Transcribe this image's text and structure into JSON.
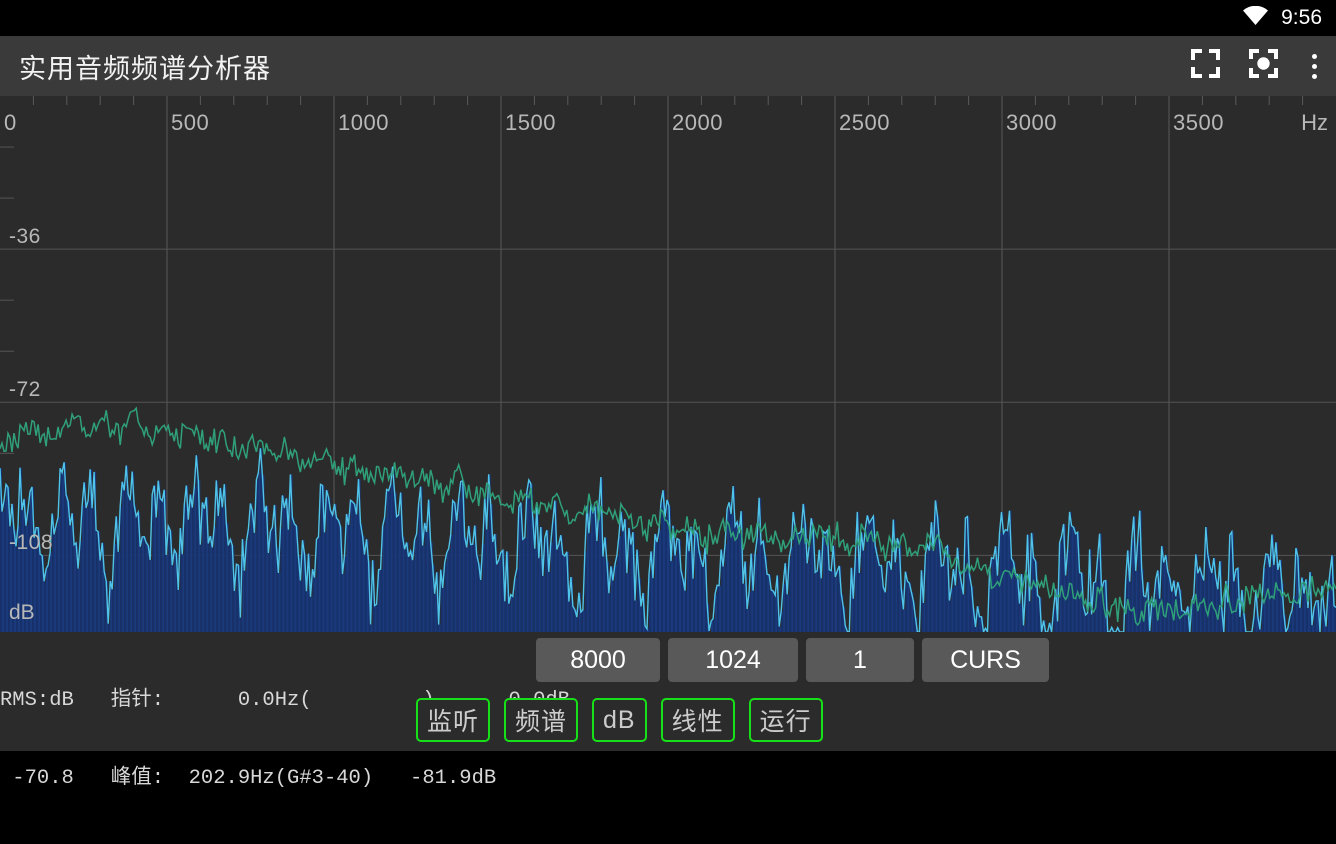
{
  "status_bar": {
    "wifi_icon": "wifi-icon",
    "time": "9:56"
  },
  "app_bar": {
    "title": "实用音频频谱分析器",
    "actions": [
      {
        "icon": "fullscreen-icon",
        "name": "fullscreen-button"
      },
      {
        "icon": "capture-focus-icon",
        "name": "capture-button"
      },
      {
        "icon": "overflow-menu-icon",
        "name": "overflow-menu-button"
      }
    ]
  },
  "readout": {
    "line1": "RMS:dB   指针:      0.0Hz(         )      0.0dB",
    "line2": " -70.8   峰值:  202.9Hz(G#3-40)   -81.9dB",
    "rms_label": "RMS:dB",
    "rms_value": "-70.8",
    "pointer_label": "指针:",
    "pointer_freq": "0.0Hz(         )",
    "pointer_db": "0.0dB",
    "peak_label": "峰值:",
    "peak_freq": "202.9Hz(G#3-40)",
    "peak_db": "-81.9dB"
  },
  "param_buttons": [
    {
      "label": "8000",
      "name": "sample-rate-button"
    },
    {
      "label": "1024",
      "name": "fft-length-button"
    },
    {
      "label": "1",
      "name": "average-button"
    },
    {
      "label": "CURS",
      "name": "cursor-button"
    }
  ],
  "mode_buttons": [
    {
      "label": "监听",
      "name": "monitor-button"
    },
    {
      "label": "频谱",
      "name": "spectrum-button"
    },
    {
      "label": "dB",
      "name": "db-scale-button"
    },
    {
      "label": "线性",
      "name": "linear-button"
    },
    {
      "label": "运行",
      "name": "run-button"
    }
  ],
  "colors": {
    "accent_green": "#18e018",
    "peak_trace": "#2fa07a",
    "live_trace": "#4fc3e8",
    "fill": "#16316b",
    "plot_bg": "#2b2b2b",
    "app_bar_bg": "#3a3a3a",
    "button_bg": "#595959"
  },
  "chart_data": {
    "type": "line",
    "title": "",
    "xlabel": "Hz",
    "ylabel": "dB",
    "xlim": [
      0,
      4000
    ],
    "ylim": [
      -126,
      0
    ],
    "grid": true,
    "x_ticks": [
      0,
      500,
      1000,
      1500,
      2000,
      2500,
      3000,
      3500
    ],
    "x_tick_labels": [
      "0",
      "500",
      "1000",
      "1500",
      "2000",
      "2500",
      "3000",
      "3500"
    ],
    "y_ticks": [
      -36,
      -72,
      -108
    ],
    "y_tick_labels": [
      "-36",
      "-72",
      "-108"
    ],
    "y_minor_ticks": [
      -12,
      -24,
      -48,
      -60,
      -84,
      -96,
      -120
    ],
    "legend": [],
    "series": [
      {
        "name": "live-spectrum",
        "color": "#4fc3e8",
        "fill_color": "#16316b",
        "values": [
          -92,
          -95,
          -99,
          -104,
          -97,
          -92,
          -96,
          -101,
          -108,
          -112,
          -103,
          -94,
          -90,
          -95,
          -100,
          -106,
          -99,
          -93,
          -97,
          -103,
          -110,
          -116,
          -107,
          -97,
          -91,
          -88,
          -92,
          -98,
          -104,
          -99,
          -94,
          -97,
          -102,
          -108,
          -113,
          -105,
          -96,
          -91,
          -94,
          -100,
          -106,
          -101,
          -95,
          -98,
          -104,
          -110,
          -116,
          -108,
          -99,
          -93,
          -90,
          -95,
          -101,
          -107,
          -102,
          -96,
          -99,
          -105,
          -111,
          -117,
          -109,
          -100,
          -94,
          -91,
          -96,
          -102,
          -108,
          -103,
          -97,
          -100,
          -106,
          -112,
          -118,
          -110,
          -101,
          -95,
          -92,
          -97,
          -103,
          -109,
          -104,
          -98,
          -101,
          -107,
          -113,
          -119,
          -111,
          -102,
          -96,
          -93,
          -98,
          -104,
          -110,
          -105,
          -99,
          -102,
          -108,
          -114,
          -120,
          -112,
          -103,
          -97,
          -94,
          -99,
          -105,
          -111,
          -106,
          -100,
          -103,
          -109,
          -115,
          -121,
          -113,
          -104,
          -98,
          -95,
          -100,
          -106,
          -112,
          -107,
          -101,
          -104,
          -110,
          -116,
          -122,
          -114,
          -105,
          -99,
          -96,
          -101,
          -107,
          -113,
          -108,
          -102,
          -105,
          -111,
          -117,
          -123,
          -115,
          -106,
          -100,
          -97,
          -102,
          -108,
          -114,
          -109,
          -103,
          -106,
          -112,
          -118,
          -124,
          -116,
          -107,
          -101,
          -98,
          -103,
          -109,
          -115,
          -110,
          -104,
          -107,
          -113,
          -119,
          -125,
          -117,
          -108,
          -102,
          -99,
          -104,
          -110,
          -116,
          -111,
          -105,
          -108,
          -114,
          -120,
          -126,
          -118,
          -109,
          -103,
          -100,
          -105,
          -111,
          -117,
          -112,
          -106,
          -109,
          -115,
          -121,
          -126,
          -119,
          -110,
          -104,
          -101,
          -106,
          -112,
          -118,
          -113,
          -107,
          -110,
          -116,
          -122,
          -126,
          -120,
          -111,
          -105,
          -102,
          -107,
          -113,
          -119,
          -114,
          -108,
          -111,
          -117,
          -123,
          -126,
          -121,
          -112,
          -106,
          -103,
          -108,
          -114,
          -120,
          -115,
          -109,
          -112,
          -118,
          -124,
          -126,
          -122,
          -113,
          -107,
          -104,
          -109,
          -115,
          -121,
          -116,
          -110,
          -113,
          -119,
          -125,
          -126,
          -123,
          -114,
          -108,
          -105,
          -110,
          -116,
          -122,
          -117,
          -111,
          -114,
          -120,
          -126,
          -126,
          -124,
          -115,
          -109
        ]
      },
      {
        "name": "peak-hold",
        "color": "#2fa07a",
        "values": [
          -84,
          -83,
          -82,
          -81,
          -80,
          -79,
          -78,
          -79,
          -80,
          -81,
          -80,
          -79,
          -78,
          -77,
          -76,
          -77,
          -78,
          -79,
          -78,
          -77,
          -76,
          -78,
          -79,
          -80,
          -78,
          -76,
          -75,
          -77,
          -79,
          -80,
          -79,
          -78,
          -77,
          -79,
          -81,
          -80,
          -79,
          -78,
          -79,
          -80,
          -82,
          -81,
          -80,
          -81,
          -82,
          -83,
          -84,
          -83,
          -82,
          -81,
          -82,
          -83,
          -84,
          -85,
          -84,
          -83,
          -84,
          -85,
          -86,
          -87,
          -86,
          -85,
          -84,
          -85,
          -86,
          -87,
          -88,
          -87,
          -86,
          -87,
          -88,
          -89,
          -90,
          -89,
          -88,
          -87,
          -88,
          -89,
          -90,
          -91,
          -90,
          -89,
          -90,
          -91,
          -92,
          -93,
          -92,
          -91,
          -90,
          -91,
          -92,
          -93,
          -94,
          -93,
          -92,
          -93,
          -94,
          -95,
          -96,
          -95,
          -94,
          -93,
          -94,
          -95,
          -96,
          -97,
          -96,
          -95,
          -96,
          -97,
          -98,
          -99,
          -98,
          -97,
          -96,
          -97,
          -98,
          -99,
          -100,
          -99,
          -98,
          -99,
          -100,
          -101,
          -102,
          -101,
          -100,
          -99,
          -100,
          -101,
          -102,
          -103,
          -102,
          -101,
          -102,
          -103,
          -104,
          -105,
          -104,
          -103,
          -102,
          -103,
          -104,
          -105,
          -104,
          -103,
          -102,
          -103,
          -104,
          -105,
          -106,
          -105,
          -104,
          -103,
          -104,
          -105,
          -104,
          -103,
          -104,
          -105,
          -104,
          -103,
          -104,
          -105,
          -106,
          -105,
          -104,
          -103,
          -104,
          -105,
          -106,
          -105,
          -104,
          -105,
          -106,
          -107,
          -108,
          -107,
          -106,
          -105,
          -106,
          -107,
          -108,
          -109,
          -110,
          -111,
          -112,
          -111,
          -110,
          -111,
          -112,
          -113,
          -114,
          -113,
          -112,
          -113,
          -114,
          -115,
          -116,
          -115,
          -114,
          -115,
          -116,
          -117,
          -118,
          -117,
          -116,
          -117,
          -118,
          -119,
          -120,
          -119,
          -118,
          -119,
          -120,
          -121,
          -120,
          -119,
          -120,
          -121,
          -122,
          -121,
          -120,
          -121,
          -122,
          -121,
          -120,
          -121,
          -122,
          -121,
          -120,
          -119,
          -120,
          -121,
          -120,
          -119,
          -118,
          -119,
          -120,
          -119,
          -118,
          -117,
          -118,
          -119,
          -118,
          -117,
          -116,
          -117,
          -118,
          -117,
          -116,
          -115,
          -116,
          -117,
          -116,
          -115,
          -114,
          -113
        ]
      }
    ]
  }
}
